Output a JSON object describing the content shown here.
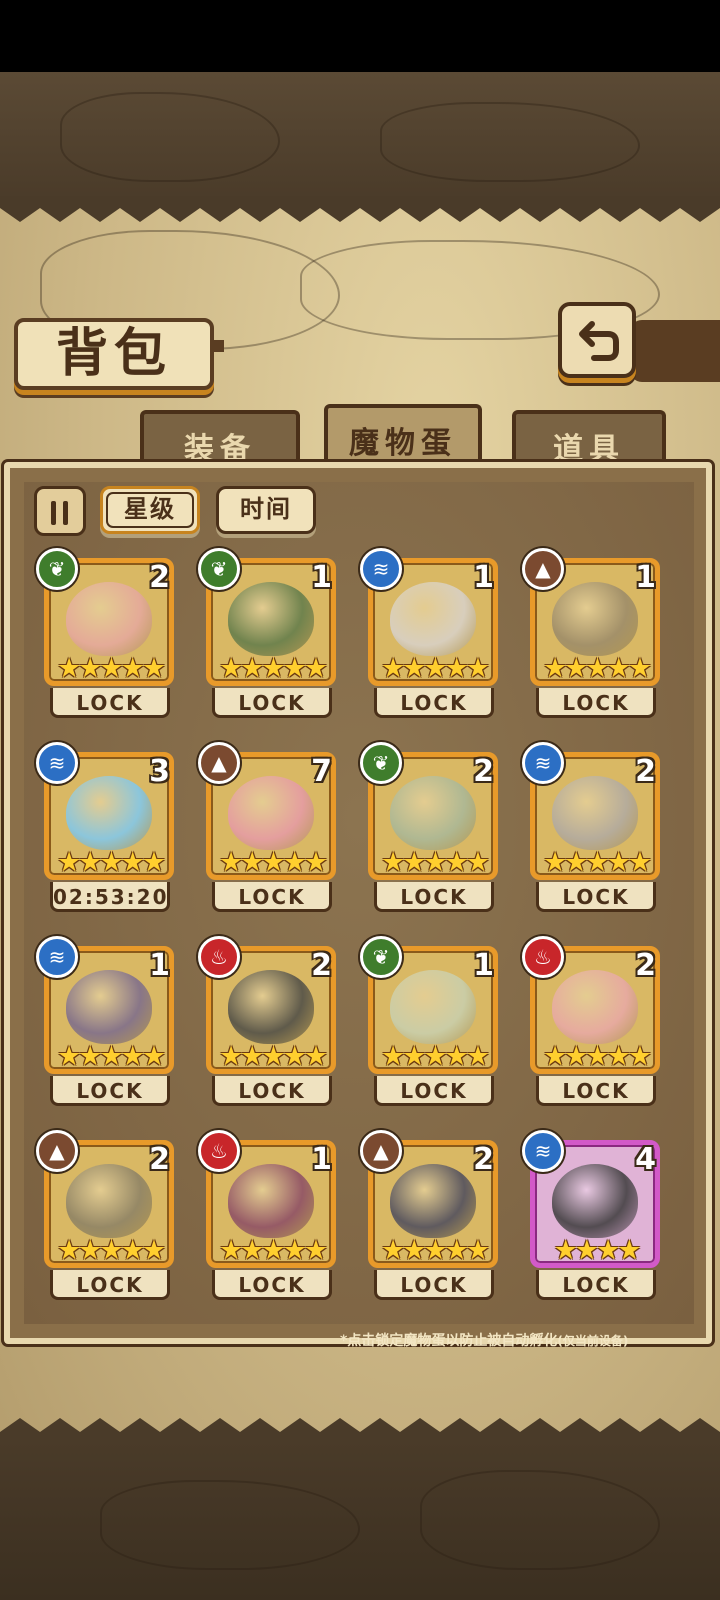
{
  "header": {
    "title": "背包",
    "back_icon": "return-arrow-icon"
  },
  "tabs": [
    {
      "label": "装备",
      "active": false
    },
    {
      "label": "魔物蛋",
      "active": true
    },
    {
      "label": "道具",
      "active": false
    }
  ],
  "sort": {
    "toggle_icon": "sort-order-icon",
    "options": [
      {
        "label": "星级",
        "active": true
      },
      {
        "label": "时间",
        "active": false
      }
    ]
  },
  "eggs": [
    {
      "element": "grass",
      "count": "2",
      "stars": 5,
      "status": "LOCK",
      "color": "#e6a8a0"
    },
    {
      "element": "grass",
      "count": "1",
      "stars": 5,
      "status": "LOCK",
      "color": "#5e7a4a"
    },
    {
      "element": "water",
      "count": "1",
      "stars": 5,
      "status": "LOCK",
      "color": "#d8d2cc"
    },
    {
      "element": "earth",
      "count": "1",
      "stars": 5,
      "status": "LOCK",
      "color": "#9a8a6a"
    },
    {
      "element": "water",
      "count": "3",
      "stars": 5,
      "status": "02:53:20",
      "color": "#7ec8f0"
    },
    {
      "element": "earth",
      "count": "7",
      "stars": 5,
      "status": "LOCK",
      "color": "#e69aa8"
    },
    {
      "element": "grass",
      "count": "2",
      "stars": 5,
      "status": "LOCK",
      "color": "#a8b89a"
    },
    {
      "element": "water",
      "count": "2",
      "stars": 5,
      "status": "LOCK",
      "color": "#b0aaa4"
    },
    {
      "element": "water",
      "count": "1",
      "stars": 5,
      "status": "LOCK",
      "color": "#7a6a8e"
    },
    {
      "element": "fire",
      "count": "2",
      "stars": 5,
      "status": "LOCK",
      "color": "#4a4a46"
    },
    {
      "element": "grass",
      "count": "1",
      "stars": 5,
      "status": "LOCK",
      "color": "#c8d0b0"
    },
    {
      "element": "fire",
      "count": "2",
      "stars": 5,
      "status": "LOCK",
      "color": "#e8a8a8"
    },
    {
      "element": "earth",
      "count": "2",
      "stars": 5,
      "status": "LOCK",
      "color": "#8a8066"
    },
    {
      "element": "fire",
      "count": "1",
      "stars": 5,
      "status": "LOCK",
      "color": "#8a4a66"
    },
    {
      "element": "earth",
      "count": "2",
      "stars": 5,
      "status": "LOCK",
      "color": "#4a4a5e"
    },
    {
      "element": "water",
      "count": "4",
      "stars": 4,
      "status": "LOCK",
      "color": "#3a3a3a",
      "rarity": "purple"
    }
  ],
  "footer_note": {
    "main": "*点击锁定魔物蛋以防止被自动孵化",
    "sub": "(仅当前设备)"
  }
}
